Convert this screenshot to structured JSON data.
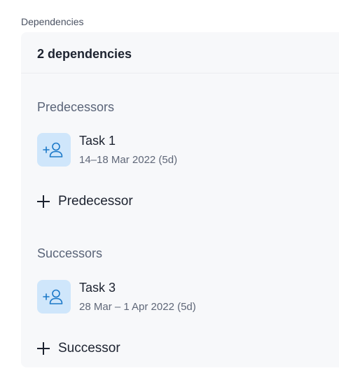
{
  "panel": {
    "section_label": "Dependencies",
    "title": "2 dependencies"
  },
  "predecessors": {
    "heading": "Predecessors",
    "items": [
      {
        "name": "Task 1",
        "dates": "14–18 Mar 2022 (5d)",
        "icon": "add-user-icon"
      }
    ],
    "add_label": "Predecessor"
  },
  "successors": {
    "heading": "Successors",
    "items": [
      {
        "name": "Task 3",
        "dates": "28 Mar – 1 Apr 2022 (5d)",
        "icon": "add-user-icon"
      }
    ],
    "add_label": "Successor"
  },
  "colors": {
    "card_background": "#f7f8fa",
    "icon_background": "#cfe6fb",
    "icon_stroke": "#1b78c8",
    "text_primary": "#1d2330",
    "text_secondary": "#5f6778"
  }
}
